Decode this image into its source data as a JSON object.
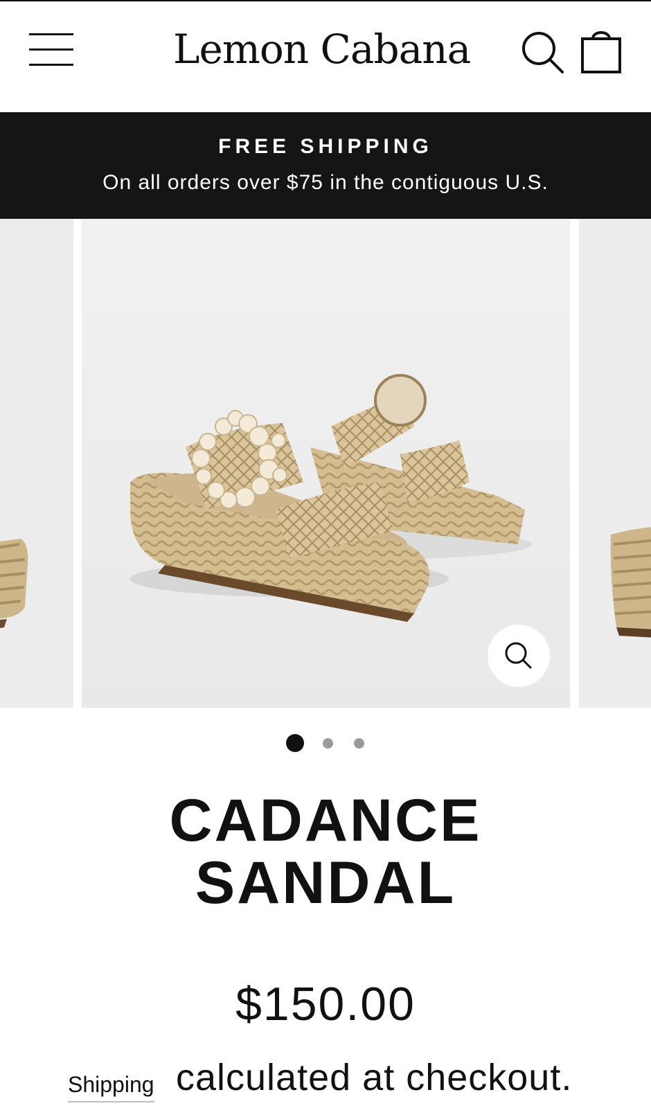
{
  "header": {
    "brand": "Lemon Cabana",
    "menu_icon": "hamburger-menu-icon",
    "search_icon": "search-icon",
    "cart_icon": "shopping-bag-icon"
  },
  "announcement": {
    "title": "FREE SHIPPING",
    "subtitle": "On all orders over $75 in the contiguous U.S."
  },
  "gallery": {
    "slide_count": 3,
    "active_slide": 1,
    "zoom_icon": "zoom-icon"
  },
  "product": {
    "title_line1": "CADANCE",
    "title_line2": "SANDAL",
    "price": "$150.00",
    "shipping_link": "Shipping",
    "shipping_text": "calculated at checkout."
  },
  "colors": {
    "announcement_bg": "#151515",
    "text": "#111111",
    "image_bg": "#eeeeee",
    "straw": "#cfb98e"
  }
}
